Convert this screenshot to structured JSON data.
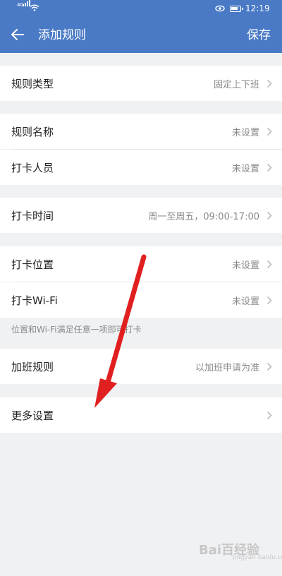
{
  "status_bar": {
    "network_badge": "4G",
    "time": "12:19",
    "battery_level_percent": 80
  },
  "app_bar": {
    "title": "添加规则",
    "save_label": "保存"
  },
  "rows": [
    {
      "label": "规则类型",
      "value": "固定上下班"
    },
    {
      "label": "规则名称",
      "value": "未设置"
    },
    {
      "label": "打卡人员",
      "value": "未设置"
    },
    {
      "label": "打卡时间",
      "value": "周一至周五，09:00-17:00"
    },
    {
      "label": "打卡位置",
      "value": "未设置"
    },
    {
      "label": "打卡Wi-Fi",
      "value": "未设置"
    },
    {
      "label": "加班规则",
      "value": "以加班申请为准"
    },
    {
      "label": "更多设置",
      "value": ""
    }
  ],
  "note": "位置和Wi-Fi满足任意一项即可打卡",
  "watermark": {
    "text": "Bai百经验",
    "sub": "jingyan.baidu.com"
  },
  "colors": {
    "header": "#4a7ac6",
    "background": "#f0f1f3",
    "arrow": "#e02020"
  },
  "icons": [
    "back-arrow-icon",
    "chevron-right-icon",
    "signal-icon",
    "wifi-icon",
    "eye-icon",
    "battery-icon"
  ]
}
